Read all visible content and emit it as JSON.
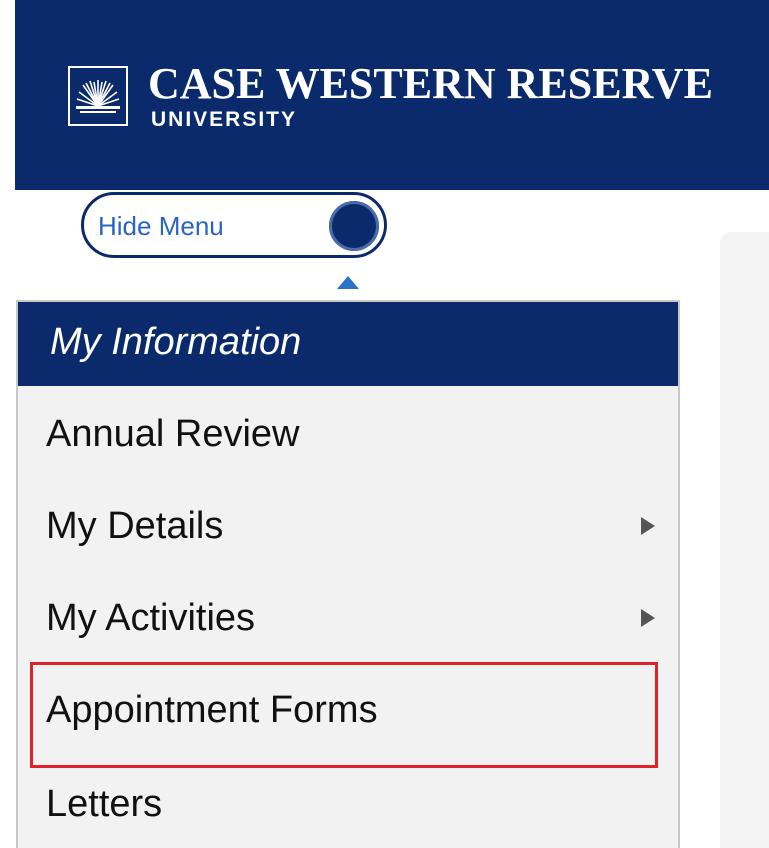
{
  "header": {
    "logo_name": "starburst-logo-icon",
    "university_line1": "CASE WESTERN RESERVE",
    "university_line2": "UNIVERSITY",
    "background_color": "#0a2a6b"
  },
  "toggle": {
    "label": "Hide Menu",
    "state": "on"
  },
  "menu": {
    "title": "My Information",
    "items": [
      {
        "label": "Annual Review",
        "has_submenu": false
      },
      {
        "label": "My Details",
        "has_submenu": true
      },
      {
        "label": "My Activities",
        "has_submenu": true
      },
      {
        "label": "Appointment Forms",
        "has_submenu": false,
        "highlighted": true
      },
      {
        "label": "Letters",
        "has_submenu": false
      }
    ]
  },
  "colors": {
    "brand_navy": "#0a2a6b",
    "link_blue": "#2a64c2",
    "highlight_red": "#d9252a",
    "menu_background": "#f2f2f2"
  }
}
